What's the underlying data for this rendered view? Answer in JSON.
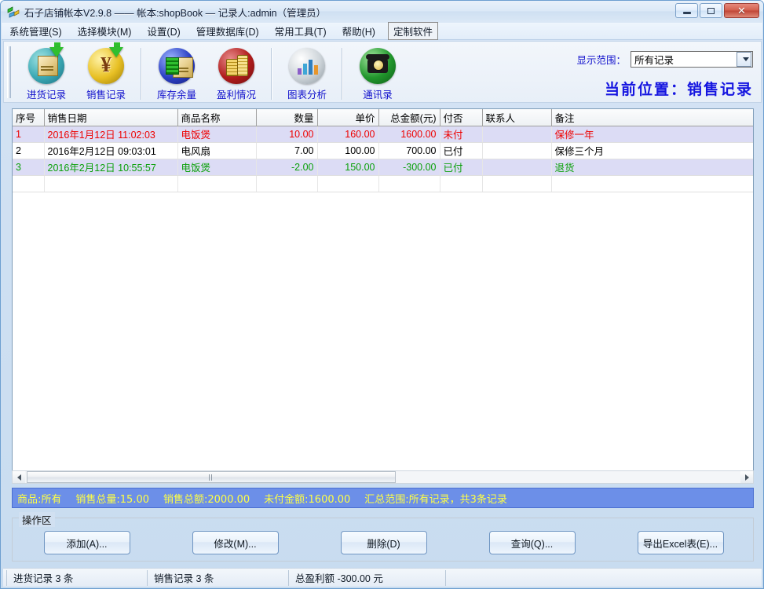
{
  "window": {
    "title": "石子店铺帐本V2.9.8  ——  帐本:shopBook — 记录人:admin（管理员）",
    "app_icon": "shop-book-icon",
    "minimize_label": "–",
    "maximize_label": "□",
    "close_label": "✕"
  },
  "menubar": {
    "items": [
      {
        "label": "系统管理(S)",
        "name": "menu-system"
      },
      {
        "label": "选择模块(M)",
        "name": "menu-module"
      },
      {
        "label": "设置(D)",
        "name": "menu-settings"
      },
      {
        "label": "管理数据库(D)",
        "name": "menu-database"
      },
      {
        "label": "常用工具(T)",
        "name": "menu-tools"
      },
      {
        "label": "帮助(H)",
        "name": "menu-help"
      },
      {
        "label": "定制软件",
        "name": "menu-custom-software"
      }
    ]
  },
  "toolbar": {
    "buttons": [
      {
        "label": "进货记录",
        "icon": "purchase-records-icon"
      },
      {
        "label": "销售记录",
        "icon": "sales-records-icon"
      },
      {
        "label": "库存余量",
        "icon": "inventory-icon"
      },
      {
        "label": "盈利情况",
        "icon": "profit-icon"
      },
      {
        "label": "图表分析",
        "icon": "chart-analysis-icon"
      },
      {
        "label": "通讯录",
        "icon": "contacts-icon"
      }
    ],
    "range_label": "显示范围：",
    "range_value": "所有记录",
    "current_position": "当前位置：销售记录"
  },
  "grid": {
    "columns": [
      {
        "key": "seq",
        "label": "序号",
        "align": "left"
      },
      {
        "key": "date",
        "label": "销售日期",
        "align": "left"
      },
      {
        "key": "product",
        "label": "商品名称",
        "align": "left"
      },
      {
        "key": "qty",
        "label": "数量",
        "align": "right"
      },
      {
        "key": "price",
        "label": "单价",
        "align": "right"
      },
      {
        "key": "total",
        "label": "总金额(元)",
        "align": "right"
      },
      {
        "key": "paid",
        "label": "付否",
        "align": "left"
      },
      {
        "key": "contact",
        "label": "联系人",
        "align": "left"
      },
      {
        "key": "remark",
        "label": "备注",
        "align": "left"
      }
    ],
    "rows": [
      {
        "seq": "1",
        "date": "2016年1月12日 11:02:03",
        "product": "电饭煲",
        "qty": "10.00",
        "price": "160.00",
        "total": "1600.00",
        "paid": "未付",
        "contact": "",
        "remark": "保修一年",
        "color": "c-red",
        "shade": "alt"
      },
      {
        "seq": "2",
        "date": "2016年2月12日 09:03:01",
        "product": "电风扇",
        "qty": "7.00",
        "price": "100.00",
        "total": "700.00",
        "paid": "已付",
        "contact": "",
        "remark": "保修三个月",
        "color": "c-black",
        "shade": "plain"
      },
      {
        "seq": "3",
        "date": "2016年2月12日 10:55:57",
        "product": "电饭煲",
        "qty": "-2.00",
        "price": "150.00",
        "total": "-300.00",
        "paid": "已付",
        "contact": "",
        "remark": "退货",
        "color": "c-green",
        "shade": "alt"
      }
    ]
  },
  "summary": {
    "product": "商品:所有",
    "total_qty": "销售总量:15.00",
    "total_amount": "销售总额:2000.00",
    "unpaid_amount": "未付金额:1600.00",
    "scope": "汇总范围:所有记录，共3条记录"
  },
  "operations": {
    "group_title": "操作区",
    "buttons": [
      {
        "label": "添加(A)...",
        "name": "add-button"
      },
      {
        "label": "修改(M)...",
        "name": "edit-button"
      },
      {
        "label": "删除(D)",
        "name": "delete-button"
      },
      {
        "label": "查询(Q)...",
        "name": "query-button"
      },
      {
        "label": "导出Excel表(E)...",
        "name": "export-excel-button"
      }
    ]
  },
  "statusbar": {
    "cells": [
      "进货记录 3 条",
      "销售记录 3 条",
      "总盈利额 -300.00 元"
    ]
  },
  "colors": {
    "accent_blue": "#1515e0",
    "summary_bg": "#6c8fe8",
    "summary_text": "#ffff44",
    "row_red": "#ee0000",
    "row_green": "#0aa00a",
    "alt_row_bg": "#dcdcf5"
  }
}
